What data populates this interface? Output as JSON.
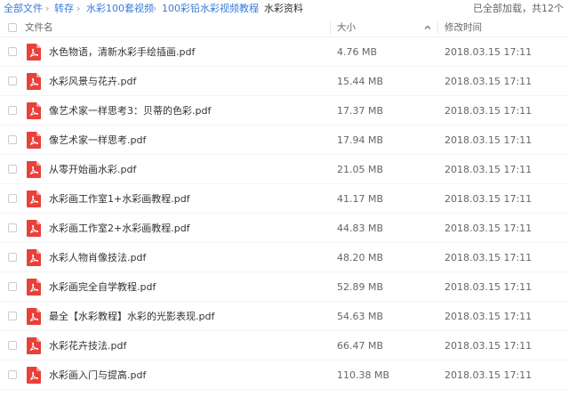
{
  "breadcrumb": {
    "items": [
      "全部文件",
      "转存",
      "水彩100套视频",
      "100彩铅水彩视频教程",
      "水彩资料"
    ],
    "separator": "›"
  },
  "status": "已全部加载，共12个",
  "columns": {
    "name": "文件名",
    "size": "大小",
    "date": "修改时间"
  },
  "colors": {
    "link": "#3a7ad9",
    "pdf_icon": "#e8413a"
  },
  "files": [
    {
      "name": "水色物语，清新水彩手绘插画.pdf",
      "size": "4.76 MB",
      "date": "2018.03.15 17:11",
      "icon": "pdf-icon"
    },
    {
      "name": "水彩风景与花卉.pdf",
      "size": "15.44 MB",
      "date": "2018.03.15 17:11",
      "icon": "pdf-icon"
    },
    {
      "name": "像艺术家一样思考3：贝蒂的色彩.pdf",
      "size": "17.37 MB",
      "date": "2018.03.15 17:11",
      "icon": "pdf-icon"
    },
    {
      "name": "像艺术家一样思考.pdf",
      "size": "17.94 MB",
      "date": "2018.03.15 17:11",
      "icon": "pdf-icon"
    },
    {
      "name": "从零开始画水彩.pdf",
      "size": "21.05 MB",
      "date": "2018.03.15 17:11",
      "icon": "pdf-icon"
    },
    {
      "name": "水彩画工作室1+水彩画教程.pdf",
      "size": "41.17 MB",
      "date": "2018.03.15 17:11",
      "icon": "pdf-icon"
    },
    {
      "name": "水彩画工作室2+水彩画教程.pdf",
      "size": "44.83 MB",
      "date": "2018.03.15 17:11",
      "icon": "pdf-icon"
    },
    {
      "name": "水彩人物肖像技法.pdf",
      "size": "48.20 MB",
      "date": "2018.03.15 17:11",
      "icon": "pdf-icon"
    },
    {
      "name": "水彩画完全自学教程.pdf",
      "size": "52.89 MB",
      "date": "2018.03.15 17:11",
      "icon": "pdf-icon"
    },
    {
      "name": "最全【水彩教程】水彩的光影表现.pdf",
      "size": "54.63 MB",
      "date": "2018.03.15 17:11",
      "icon": "pdf-icon"
    },
    {
      "name": "水彩花卉技法.pdf",
      "size": "66.47 MB",
      "date": "2018.03.15 17:11",
      "icon": "pdf-icon"
    },
    {
      "name": "水彩画入门与提高.pdf",
      "size": "110.38 MB",
      "date": "2018.03.15 17:11",
      "icon": "pdf-icon"
    }
  ]
}
